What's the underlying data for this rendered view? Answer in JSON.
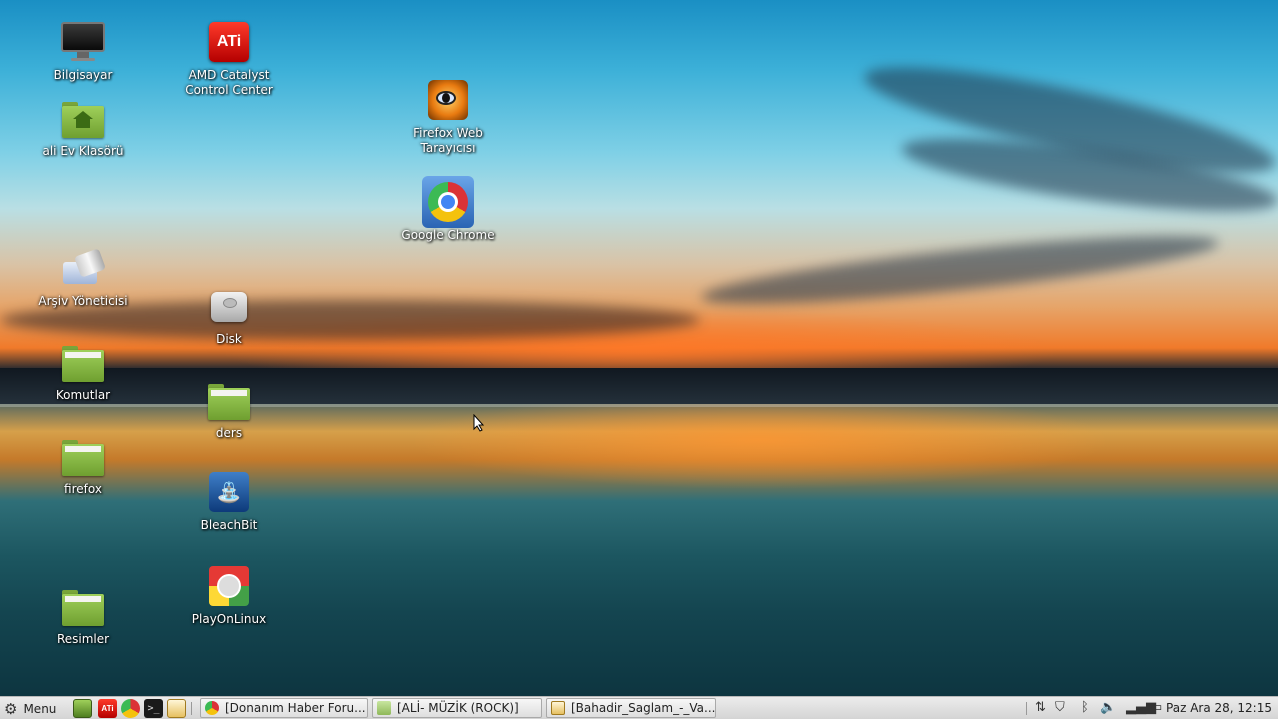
{
  "desktop": {
    "icons": [
      {
        "id": "bilgisayar",
        "label": "Bilgisayar",
        "icon": "computer-icon"
      },
      {
        "id": "home",
        "label": "ali Ev Klasörü",
        "icon": "home-folder-icon"
      },
      {
        "id": "arsiv",
        "label": "Arşiv Yöneticisi",
        "icon": "archive-manager-icon"
      },
      {
        "id": "komutlar",
        "label": "Komutlar",
        "icon": "folder-icon"
      },
      {
        "id": "firefox-folder",
        "label": "firefox",
        "icon": "folder-icon"
      },
      {
        "id": "resimler",
        "label": "Resimler",
        "icon": "folder-icon"
      },
      {
        "id": "amd",
        "label": "AMD Catalyst Control Center",
        "icon": "ati-icon"
      },
      {
        "id": "disk",
        "label": "Disk",
        "icon": "hard-disk-icon"
      },
      {
        "id": "ders",
        "label": "ders",
        "icon": "folder-icon"
      },
      {
        "id": "bleachbit",
        "label": "BleachBit",
        "icon": "bleachbit-icon"
      },
      {
        "id": "playonlinux",
        "label": "PlayOnLinux",
        "icon": "playonlinux-icon"
      },
      {
        "id": "firefox-web",
        "label": "Firefox Web Tarayıcısı",
        "icon": "firefox-icon"
      },
      {
        "id": "chrome",
        "label": "Google Chrome",
        "icon": "chrome-icon"
      }
    ],
    "ati_logo_text": "ATi"
  },
  "taskbar": {
    "menu_label": "Menu",
    "launchers": [
      "file-manager-icon",
      "ati-icon",
      "chrome-icon",
      "terminal-icon",
      "text-editor-icon"
    ],
    "tasks": [
      {
        "label": "[Donanım Haber Foru...",
        "icon": "chrome-icon"
      },
      {
        "label": "[ALİ- MÜZİK (ROCK)]",
        "icon": "folder-icon"
      },
      {
        "label": "[Bahadir_Saglam_-_Va...",
        "icon": "document-icon"
      }
    ],
    "tray": [
      "network-icon",
      "shield-icon",
      "bluetooth-icon",
      "volume-icon",
      "signal-icon",
      "battery-icon"
    ],
    "clock": "Paz Ara 28, 12:15"
  }
}
